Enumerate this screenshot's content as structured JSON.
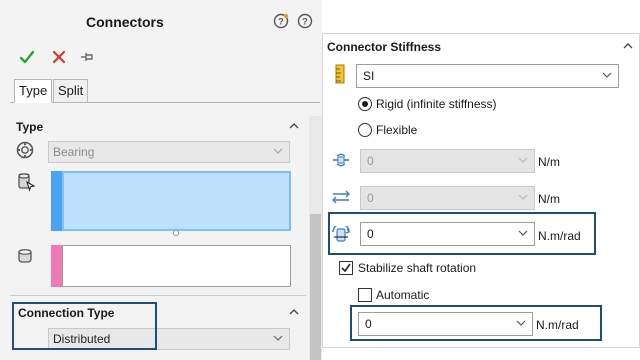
{
  "left": {
    "title": "Connectors",
    "tabs": [
      {
        "label": "Type"
      },
      {
        "label": "Split"
      }
    ],
    "type_section": {
      "header": "Type",
      "bearing_value": "Bearing"
    },
    "connection_type": {
      "header": "Connection Type",
      "value": "Distributed"
    }
  },
  "right": {
    "header": "Connector Stiffness",
    "unit_system": "SI",
    "rigid_label": "Rigid (infinite stiffness)",
    "flexible_label": "Flexible",
    "selected_mode": "rigid",
    "fields": [
      {
        "value": "0",
        "unit": "N/m",
        "disabled": true
      },
      {
        "value": "0",
        "unit": "N/m",
        "disabled": true
      },
      {
        "value": "0",
        "unit": "N.m/rad",
        "disabled": false
      }
    ],
    "stabilize": {
      "label": "Stabilize shaft rotation",
      "checked": true
    },
    "automatic": {
      "label": "Automatic",
      "checked": false
    },
    "shaft_field": {
      "value": "0",
      "unit": "N.m/rad"
    }
  },
  "colors": {
    "accent_blue": "#1e4e7a",
    "list_blue": "#4aa3f0",
    "list_pink": "#f07ab8",
    "ok_green": "#2fa12f",
    "cancel_red": "#d23a2a"
  },
  "icons": [
    "help-feature-icon",
    "help-icon",
    "ok-check-icon",
    "cancel-x-icon",
    "pin-icon",
    "bearing-icon",
    "face-select-icon",
    "cylinder-select-icon",
    "unit-ruler-icon",
    "axial-stiffness-icon",
    "lateral-stiffness-icon",
    "rotational-stiffness-icon"
  ]
}
